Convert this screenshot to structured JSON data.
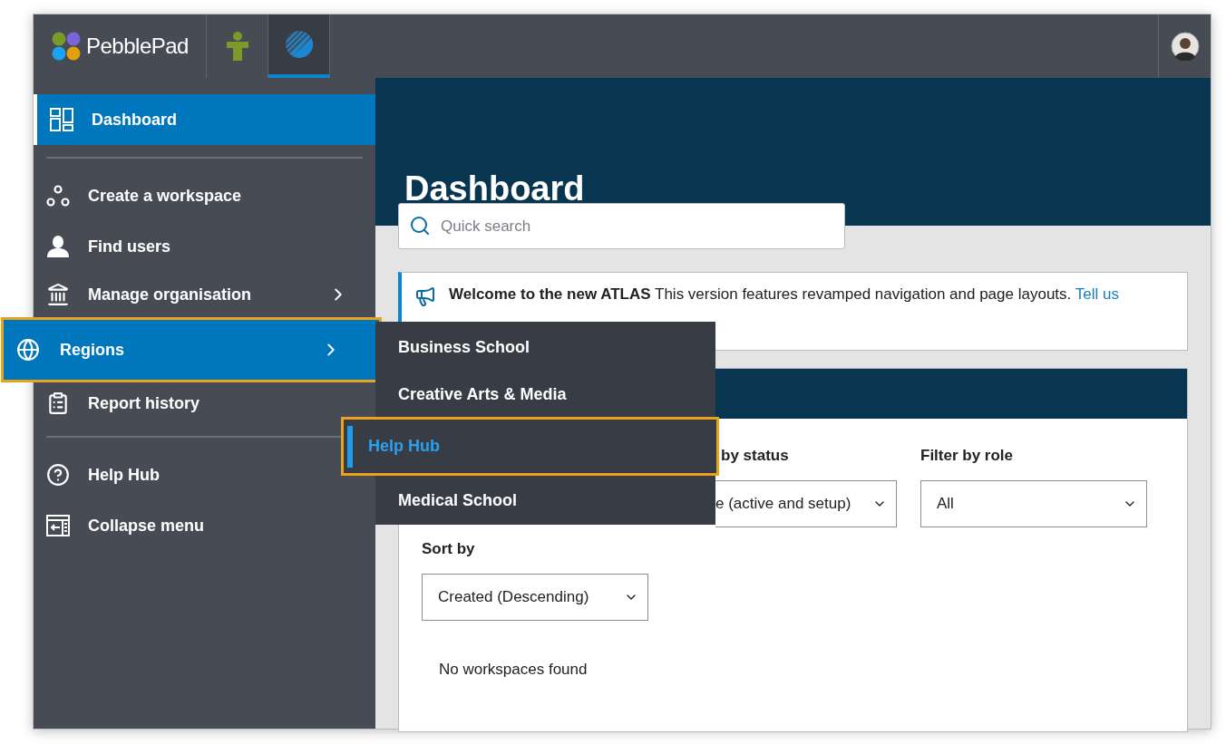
{
  "top_bar": {
    "logo": "PebblePad",
    "apps": [
      {
        "kind": "person",
        "selected": false
      },
      {
        "kind": "atlas",
        "selected": true
      }
    ]
  },
  "sidebar": {
    "items": [
      {
        "kind": "dashboard",
        "label": "Dashboard",
        "selected": true,
        "submenu": false,
        "highlighted": false
      },
      {
        "kind": "divider"
      },
      {
        "kind": "workspace",
        "label": "Create a workspace",
        "selected": false,
        "submenu": false,
        "highlighted": false
      },
      {
        "kind": "user",
        "label": "Find users",
        "selected": false,
        "submenu": false,
        "highlighted": false
      },
      {
        "kind": "organisation",
        "label": "Manage organisation",
        "selected": false,
        "submenu": true,
        "highlighted": false
      },
      {
        "kind": "globe",
        "label": "Regions",
        "selected": true,
        "submenu": true,
        "highlighted": true
      },
      {
        "kind": "report",
        "label": "Report history",
        "selected": false,
        "submenu": false,
        "highlighted": false
      },
      {
        "kind": "divider"
      },
      {
        "kind": "help",
        "label": "Help Hub",
        "selected": false,
        "submenu": false,
        "highlighted": false
      },
      {
        "kind": "collapse",
        "label": "Collapse menu",
        "selected": false,
        "submenu": false,
        "highlighted": false
      }
    ]
  },
  "flyout": {
    "items": [
      {
        "label": "Business School",
        "selected": false,
        "highlighted": false
      },
      {
        "label": "Creative Arts & Media",
        "selected": false,
        "highlighted": false
      },
      {
        "label": "Help Hub",
        "selected": true,
        "highlighted": true
      },
      {
        "label": "Medical School",
        "selected": false,
        "highlighted": false
      }
    ]
  },
  "main": {
    "title": "Dashboard",
    "search": {
      "placeholder": "Quick search"
    },
    "notice": {
      "heading": "Welcome to the new ATLAS",
      "text": "This version features revamped navigation and page layouts.",
      "link": "Tell us"
    },
    "workspaces": {
      "filters": [
        {
          "label": "by status",
          "value": "e (active and setup)"
        },
        {
          "label": "Filter by role",
          "value": "All"
        }
      ],
      "sort": {
        "label": "Sort by",
        "value": "Created (Descending)"
      },
      "empty": "No workspaces found"
    }
  }
}
